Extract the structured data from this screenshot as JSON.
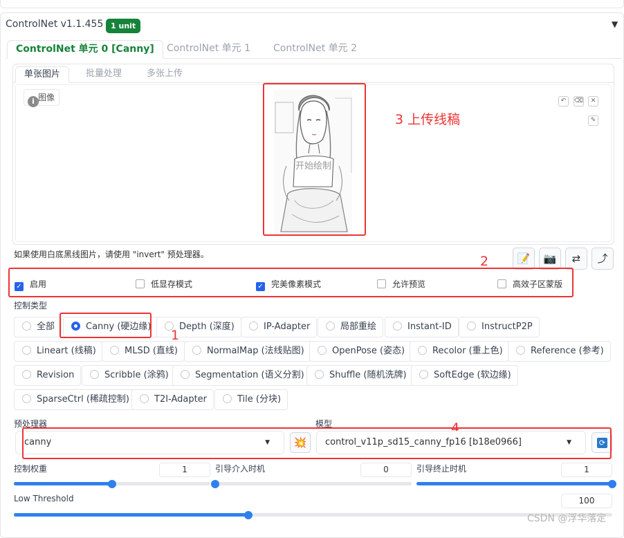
{
  "header": {
    "title": "ControlNet v1.1.455",
    "badge": "1 unit",
    "collapse_icon": "triangle-down-icon"
  },
  "unit_tabs": [
    {
      "label": "ControlNet 单元 0 [Canny]",
      "active": true
    },
    {
      "label": "ControlNet 单元 1",
      "active": false
    },
    {
      "label": "ControlNet 单元 2",
      "active": false
    }
  ],
  "image_tabs": [
    {
      "label": "单张图片",
      "active": true
    },
    {
      "label": "批量处理",
      "active": false
    },
    {
      "label": "多张上传",
      "active": false
    }
  ],
  "image_panel": {
    "label": "图像",
    "overlay_text": "开始绘制",
    "mini_buttons": [
      "undo-icon",
      "eraser-icon",
      "close-icon",
      "brush-icon"
    ]
  },
  "annotations": {
    "a1": "1",
    "a2": "2",
    "a3": "3 上传线稿",
    "a4": "4"
  },
  "hint": "如果使用白底黑线图片，请使用 \"invert\" 预处理器。",
  "toolbar": [
    "edit-icon",
    "camera-icon",
    "swap-icon",
    "send-arrow-icon"
  ],
  "options": [
    {
      "label": "启用",
      "checked": true
    },
    {
      "label": "低显存模式",
      "checked": false
    },
    {
      "label": "完美像素模式",
      "checked": true
    },
    {
      "label": "允许预览",
      "checked": false
    },
    {
      "label": "高效子区蒙版",
      "checked": false
    }
  ],
  "control_type": {
    "label": "控制类型",
    "rows": [
      [
        {
          "label": "全部",
          "selected": false
        },
        {
          "label": "Canny (硬边缘)",
          "selected": true
        },
        {
          "label": "Depth (深度)",
          "selected": false
        },
        {
          "label": "IP-Adapter",
          "selected": false
        },
        {
          "label": "局部重绘",
          "selected": false
        },
        {
          "label": "Instant-ID",
          "selected": false
        },
        {
          "label": "InstructP2P",
          "selected": false
        }
      ],
      [
        {
          "label": "Lineart (线稿)",
          "selected": false
        },
        {
          "label": "MLSD (直线)",
          "selected": false
        },
        {
          "label": "NormalMap (法线贴图)",
          "selected": false
        },
        {
          "label": "OpenPose (姿态)",
          "selected": false
        },
        {
          "label": "Recolor (重上色)",
          "selected": false
        },
        {
          "label": "Reference (参考)",
          "selected": false
        }
      ],
      [
        {
          "label": "Revision",
          "selected": false
        },
        {
          "label": "Scribble (涂鸦)",
          "selected": false
        },
        {
          "label": "Segmentation (语义分割)",
          "selected": false
        },
        {
          "label": "Shuffle (随机洗牌)",
          "selected": false
        },
        {
          "label": "SoftEdge (软边缘)",
          "selected": false
        }
      ],
      [
        {
          "label": "SparseCtrl (稀疏控制)",
          "selected": false
        },
        {
          "label": "T2I-Adapter",
          "selected": false
        },
        {
          "label": "Tile (分块)",
          "selected": false
        }
      ]
    ]
  },
  "preprocessor": {
    "label": "预处理器",
    "value": "canny",
    "run_icon": "explosion-icon"
  },
  "model": {
    "label": "模型",
    "value": "control_v11p_sd15_canny_fp16 [b18e0966]",
    "refresh_icon": "refresh-icon"
  },
  "sliders": [
    {
      "label": "控制权重",
      "value": "1",
      "fraction": 0.5
    },
    {
      "label": "引导介入时机",
      "value": "0",
      "fraction": 0.0
    },
    {
      "label": "引导终止时机",
      "value": "1",
      "fraction": 1.0
    },
    {
      "label": "Low Threshold",
      "value": "100",
      "fraction": 0.392
    }
  ],
  "watermark": "CSDN @浮华落定",
  "colors": {
    "accent": "#2563eb",
    "brand_green": "#16833a",
    "annotation_red": "#e33"
  }
}
